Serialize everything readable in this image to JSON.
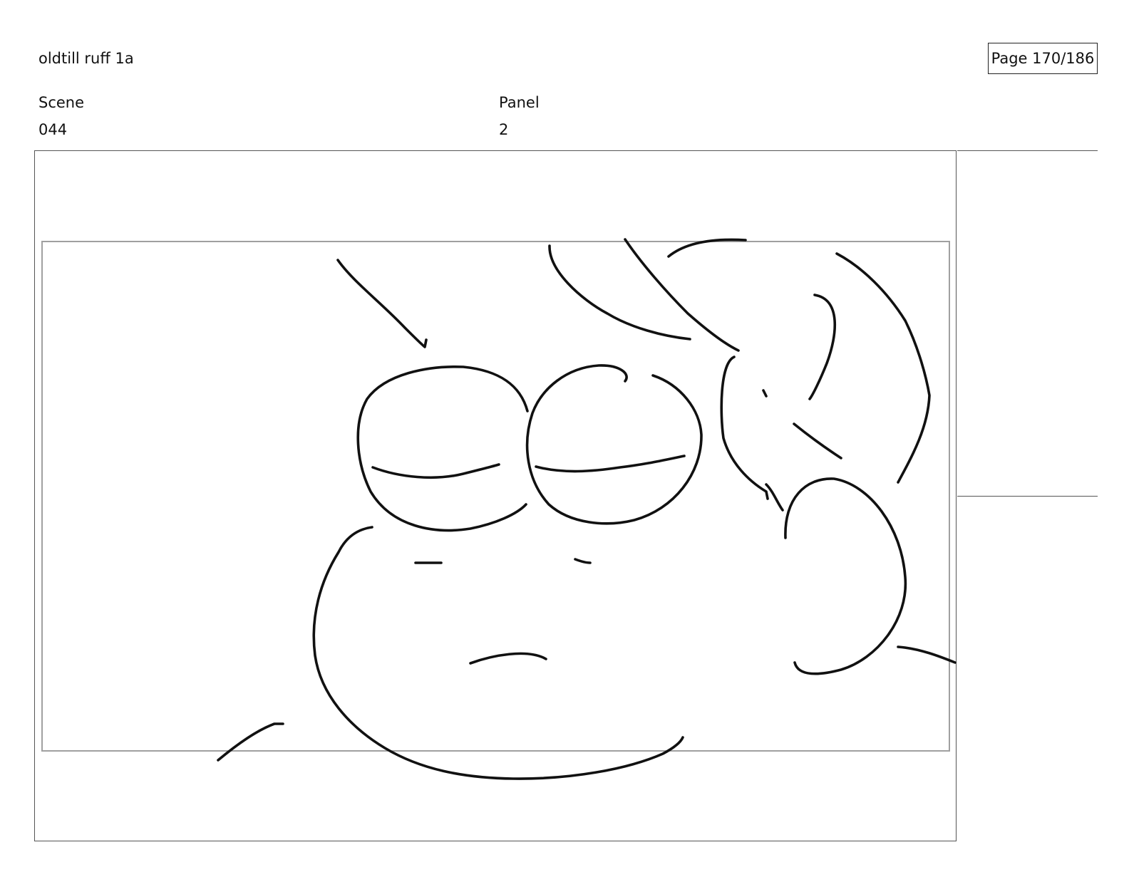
{
  "header": {
    "project_title": "oldtill ruff 1a",
    "page_indicator": "Page 170/186"
  },
  "meta": {
    "scene_label": "Scene",
    "scene_value": "044",
    "panel_label": "Panel",
    "panel_value": "2"
  },
  "colors": {
    "ink": "#111111",
    "frame": "#555555",
    "safe_area": "#a0a0a0",
    "background": "#ffffff"
  }
}
